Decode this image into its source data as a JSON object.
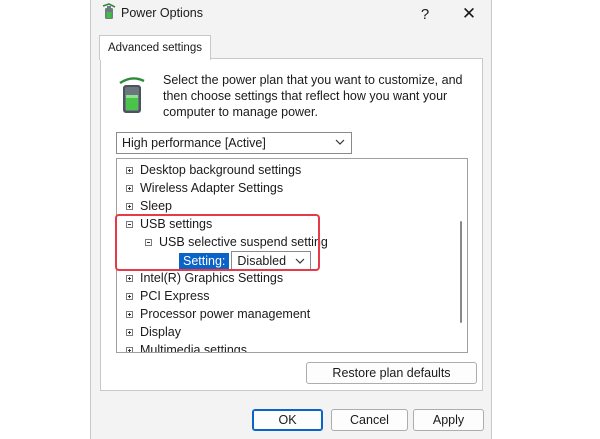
{
  "window": {
    "title": "Power Options",
    "help_label": "?",
    "close_label": "✕"
  },
  "tab": {
    "label": "Advanced settings"
  },
  "description": "Select the power plan that you want to customize, and then choose settings that reflect how you want your computer to manage power.",
  "plan_select": {
    "value": "High performance [Active]"
  },
  "tree": {
    "items": [
      {
        "label": "Desktop background settings",
        "expander": "plus"
      },
      {
        "label": "Wireless Adapter Settings",
        "expander": "plus"
      },
      {
        "label": "Sleep",
        "expander": "plus"
      },
      {
        "label": "USB settings",
        "expander": "minus"
      },
      {
        "label": "USB selective suspend setting",
        "expander": "minus"
      },
      {
        "label": "Intel(R) Graphics Settings",
        "expander": "plus"
      },
      {
        "label": "PCI Express",
        "expander": "plus"
      },
      {
        "label": "Processor power management",
        "expander": "plus"
      },
      {
        "label": "Display",
        "expander": "plus"
      },
      {
        "label": "Multimedia settings",
        "expander": "plus"
      }
    ],
    "setting": {
      "label": "Setting:",
      "value": "Disabled"
    }
  },
  "buttons": {
    "restore": "Restore plan defaults",
    "ok": "OK",
    "cancel": "Cancel",
    "apply": "Apply"
  },
  "colors": {
    "accent": "#0a64c8",
    "highlight_border": "#e53a47",
    "window_bg": "#f3f3f3"
  }
}
